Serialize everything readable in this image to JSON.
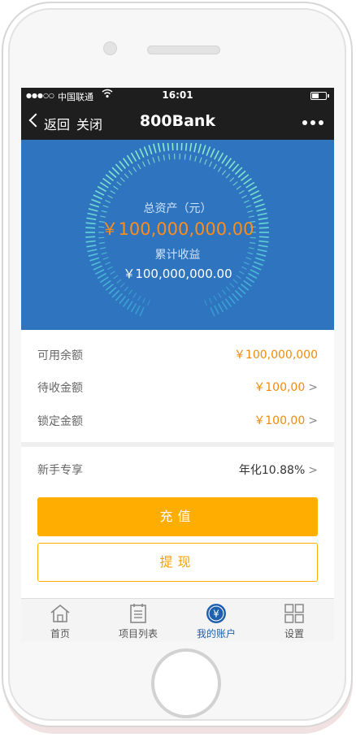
{
  "status_bar": {
    "signal": "●●●○○",
    "carrier": "中国联通",
    "time": "16:01"
  },
  "nav": {
    "back_label": "返回",
    "close_label": "关闭",
    "title": "800Bank",
    "more_icon": "more-dots-icon"
  },
  "summary": {
    "total_assets_label": "总资产（元）",
    "total_assets_value": "￥100,000,000.00",
    "cumulative_income_label": "累计收益",
    "cumulative_income_value": "￥100,000,000.00"
  },
  "balances": [
    {
      "label": "可用余额",
      "value": "￥100,000,000",
      "chevron": ""
    },
    {
      "label": "待收金额",
      "value": "￥100,00",
      "chevron": ">"
    },
    {
      "label": "锁定金额",
      "value": "￥100,00",
      "chevron": ">"
    }
  ],
  "promo": {
    "label": "新手专享",
    "value": "年化10.88%",
    "chevron": ">"
  },
  "actions": {
    "deposit_label": "充值",
    "withdraw_label": "提现"
  },
  "tabs": [
    {
      "label": "首页",
      "icon": "home-icon",
      "active": false
    },
    {
      "label": "项目列表",
      "icon": "list-icon",
      "active": false
    },
    {
      "label": "我的账户",
      "icon": "account-yen-icon",
      "active": true
    },
    {
      "label": "设置",
      "icon": "settings-grid-icon",
      "active": false
    }
  ],
  "colors": {
    "hero_bg": "#2f74be",
    "accent_orange": "#ff8d1a",
    "button_yellow": "#ffae00",
    "tab_active": "#1f5fb0",
    "bar_dark": "#1e1e1e"
  }
}
